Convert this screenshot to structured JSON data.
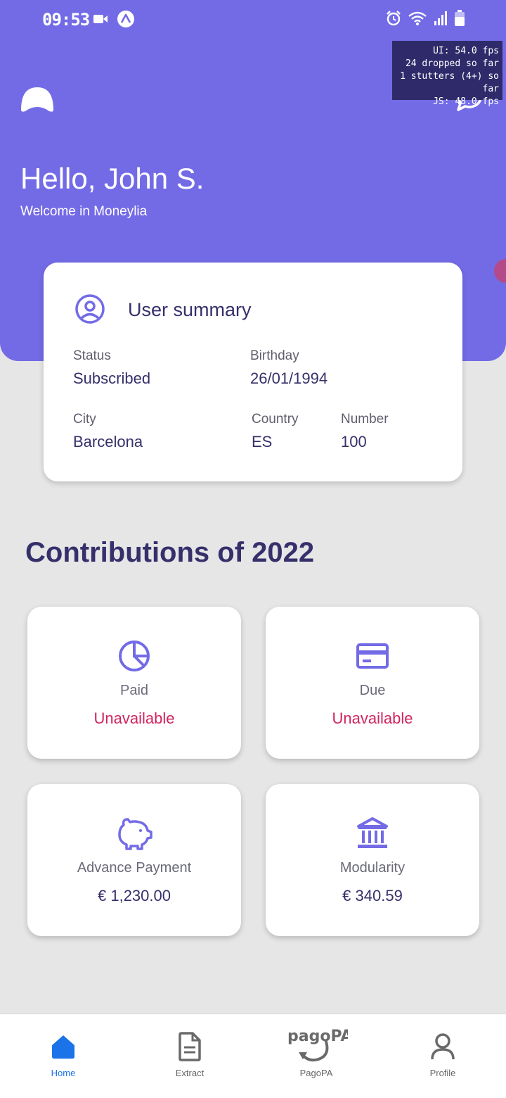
{
  "status_bar": {
    "time": "09:53"
  },
  "perf_overlay": {
    "lines": [
      "UI: 54.0 fps",
      "24 dropped so far",
      "1 stutters (4+) so far",
      "JS: 48.0 fps"
    ]
  },
  "header": {
    "greeting": "Hello, John S.",
    "welcome": "Welcome in Moneylia"
  },
  "summary": {
    "title": "User summary",
    "status_label": "Status",
    "status_value": "Subscribed",
    "birthday_label": "Birthday",
    "birthday_value": "26/01/1994",
    "city_label": "City",
    "city_value": "Barcelona",
    "country_label": "Country",
    "country_value": "ES",
    "number_label": "Number",
    "number_value": "100"
  },
  "contributions": {
    "title": "Contributions of 2022",
    "cards": [
      {
        "label": "Paid",
        "value": "Unavailable",
        "icon": "pie-chart-icon"
      },
      {
        "label": "Due",
        "value": "Unavailable",
        "icon": "credit-card-icon"
      },
      {
        "label": "Advance Payment",
        "value": "€ 1,230.00",
        "icon": "piggy-bank-icon"
      },
      {
        "label": "Modularity",
        "value": "€ 340.59",
        "icon": "bank-building-icon"
      }
    ]
  },
  "nav": {
    "items": [
      {
        "label": "Home",
        "icon": "home-icon",
        "active": true
      },
      {
        "label": "Extract",
        "icon": "document-icon",
        "active": false
      },
      {
        "label": "PagoPA",
        "icon": "pagopa-icon",
        "logo_text": "pagoPA",
        "active": false
      },
      {
        "label": "Profile",
        "icon": "person-icon",
        "active": false
      }
    ]
  },
  "colors": {
    "primary": "#736be6",
    "text_dark": "#35306b",
    "unavailable": "#d0245f",
    "nav_active": "#1a73e8"
  }
}
